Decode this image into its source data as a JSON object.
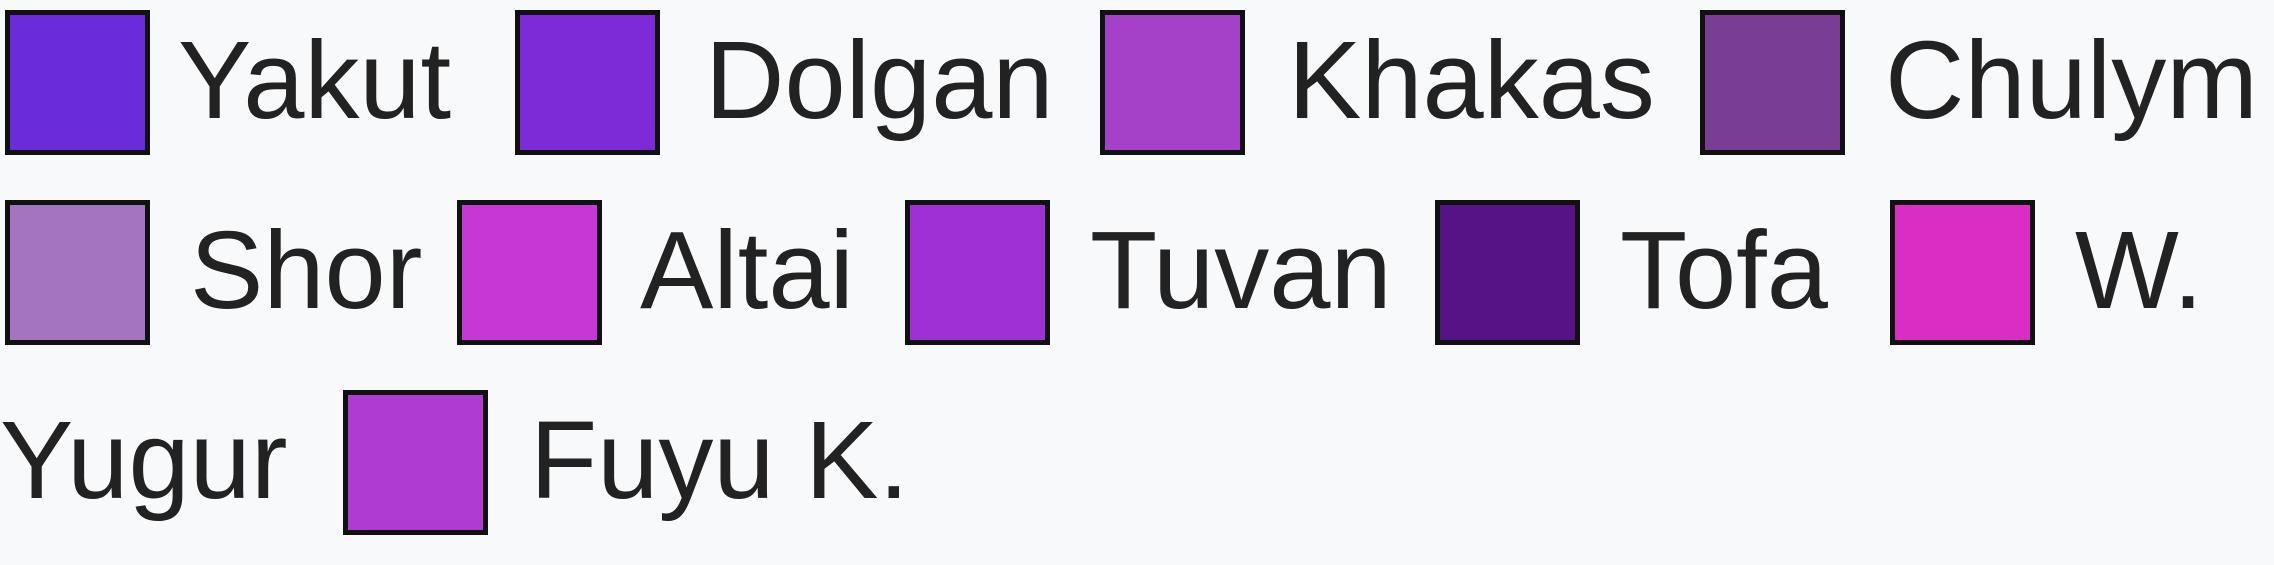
{
  "chart_data": {
    "type": "legend",
    "title": "",
    "items": [
      {
        "label": "Yakut",
        "color": "#6a2bd9"
      },
      {
        "label": "Dolgan",
        "color": "#7d2bd6"
      },
      {
        "label": "Khakas",
        "color": "#a541c8"
      },
      {
        "label": "Chulym",
        "color": "#793d96"
      },
      {
        "label": "Shor",
        "color": "#a574c0"
      },
      {
        "label": "Altai",
        "color": "#c637d6"
      },
      {
        "label": "Tuvan",
        "color": "#9e30d6"
      },
      {
        "label": "Tofa",
        "color": "#551386"
      },
      {
        "label": "W.",
        "color": "#db2dc4"
      },
      {
        "label": "Fuyu K.",
        "color": "#b03bd2"
      }
    ],
    "wrapped_label_continuation": "Yugur"
  }
}
